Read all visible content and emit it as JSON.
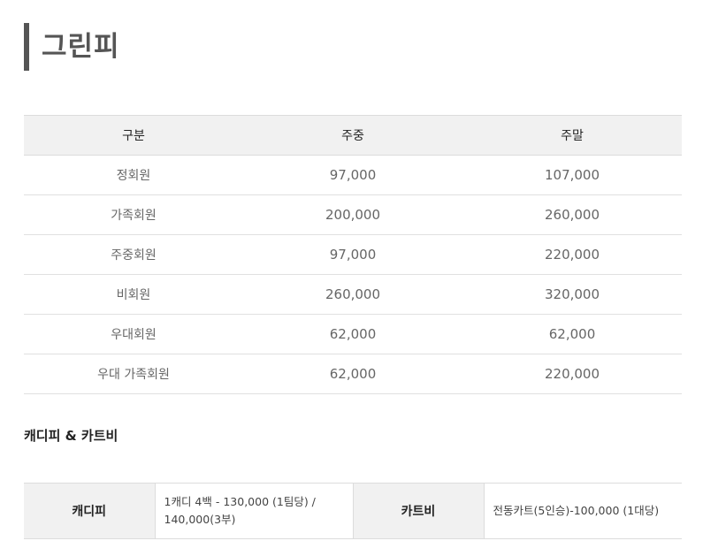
{
  "title": "그린피",
  "green_fee": {
    "headers": [
      "구분",
      "주중",
      "주말"
    ],
    "rows": [
      {
        "type": "정회원",
        "weekday": "97,000",
        "weekend": "107,000"
      },
      {
        "type": "가족회원",
        "weekday": "200,000",
        "weekend": "260,000"
      },
      {
        "type": "주중회원",
        "weekday": "97,000",
        "weekend": "220,000"
      },
      {
        "type": "비회원",
        "weekday": "260,000",
        "weekend": "320,000"
      },
      {
        "type": "우대회원",
        "weekday": "62,000",
        "weekend": "62,000"
      },
      {
        "type": "우대 가족회원",
        "weekday": "62,000",
        "weekend": "220,000"
      }
    ]
  },
  "caddie_cart": {
    "section_title": "캐디피 & 카트비",
    "caddie_label": "캐디피",
    "caddie_value_line1": "1캐디 4백 - 130,000 (1팀당) /",
    "caddie_value_line2": "140,000(3부)",
    "cart_label": "카트비",
    "cart_value": "전동카트(5인승)-100,000 (1대당)"
  }
}
